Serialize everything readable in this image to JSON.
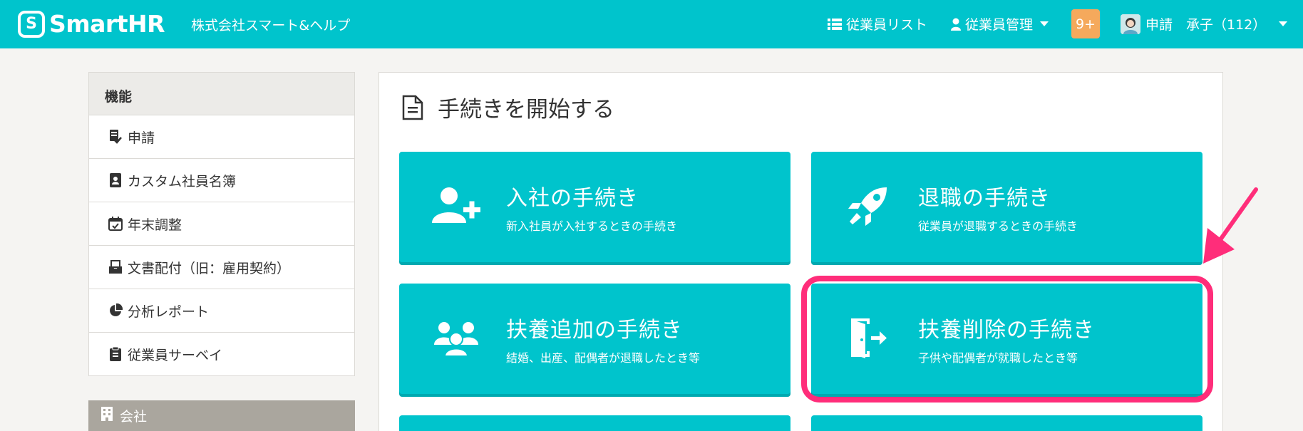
{
  "header": {
    "logo_text": "SmartHR",
    "company": "株式会社スマート&ヘルプ",
    "nav_list": "従業員リスト",
    "nav_manage": "従業員管理",
    "badge": "9+",
    "user_name": "申請　承子（112）"
  },
  "sidebar": {
    "heading": "機能",
    "items": [
      {
        "label": "申請",
        "icon": "checklist-icon"
      },
      {
        "label": "カスタム社員名簿",
        "icon": "address-book-icon"
      },
      {
        "label": "年末調整",
        "icon": "calendar-check-icon"
      },
      {
        "label": "文書配付（旧：雇用契約）",
        "icon": "inbox-icon"
      },
      {
        "label": "分析レポート",
        "icon": "pie-chart-icon"
      },
      {
        "label": "従業員サーベイ",
        "icon": "clipboard-icon"
      }
    ],
    "company_label": "会社"
  },
  "main": {
    "title": "手続きを開始する",
    "cards": [
      {
        "title": "入社の手続き",
        "subtitle": "新入社員が入社するときの手続き",
        "icon": "user-plus-icon"
      },
      {
        "title": "退職の手続き",
        "subtitle": "従業員が退職するときの手続き",
        "icon": "rocket-icon"
      },
      {
        "title": "扶養追加の手続き",
        "subtitle": "結婚、出産、配偶者が退職したとき等",
        "icon": "users-icon"
      },
      {
        "title": "扶養削除の手続き",
        "subtitle": "子供や配偶者が就職したとき等",
        "icon": "door-exit-icon"
      }
    ]
  },
  "colors": {
    "brand": "#00c4cc",
    "badge": "#f5a95c",
    "highlight": "#ff2d7a"
  }
}
